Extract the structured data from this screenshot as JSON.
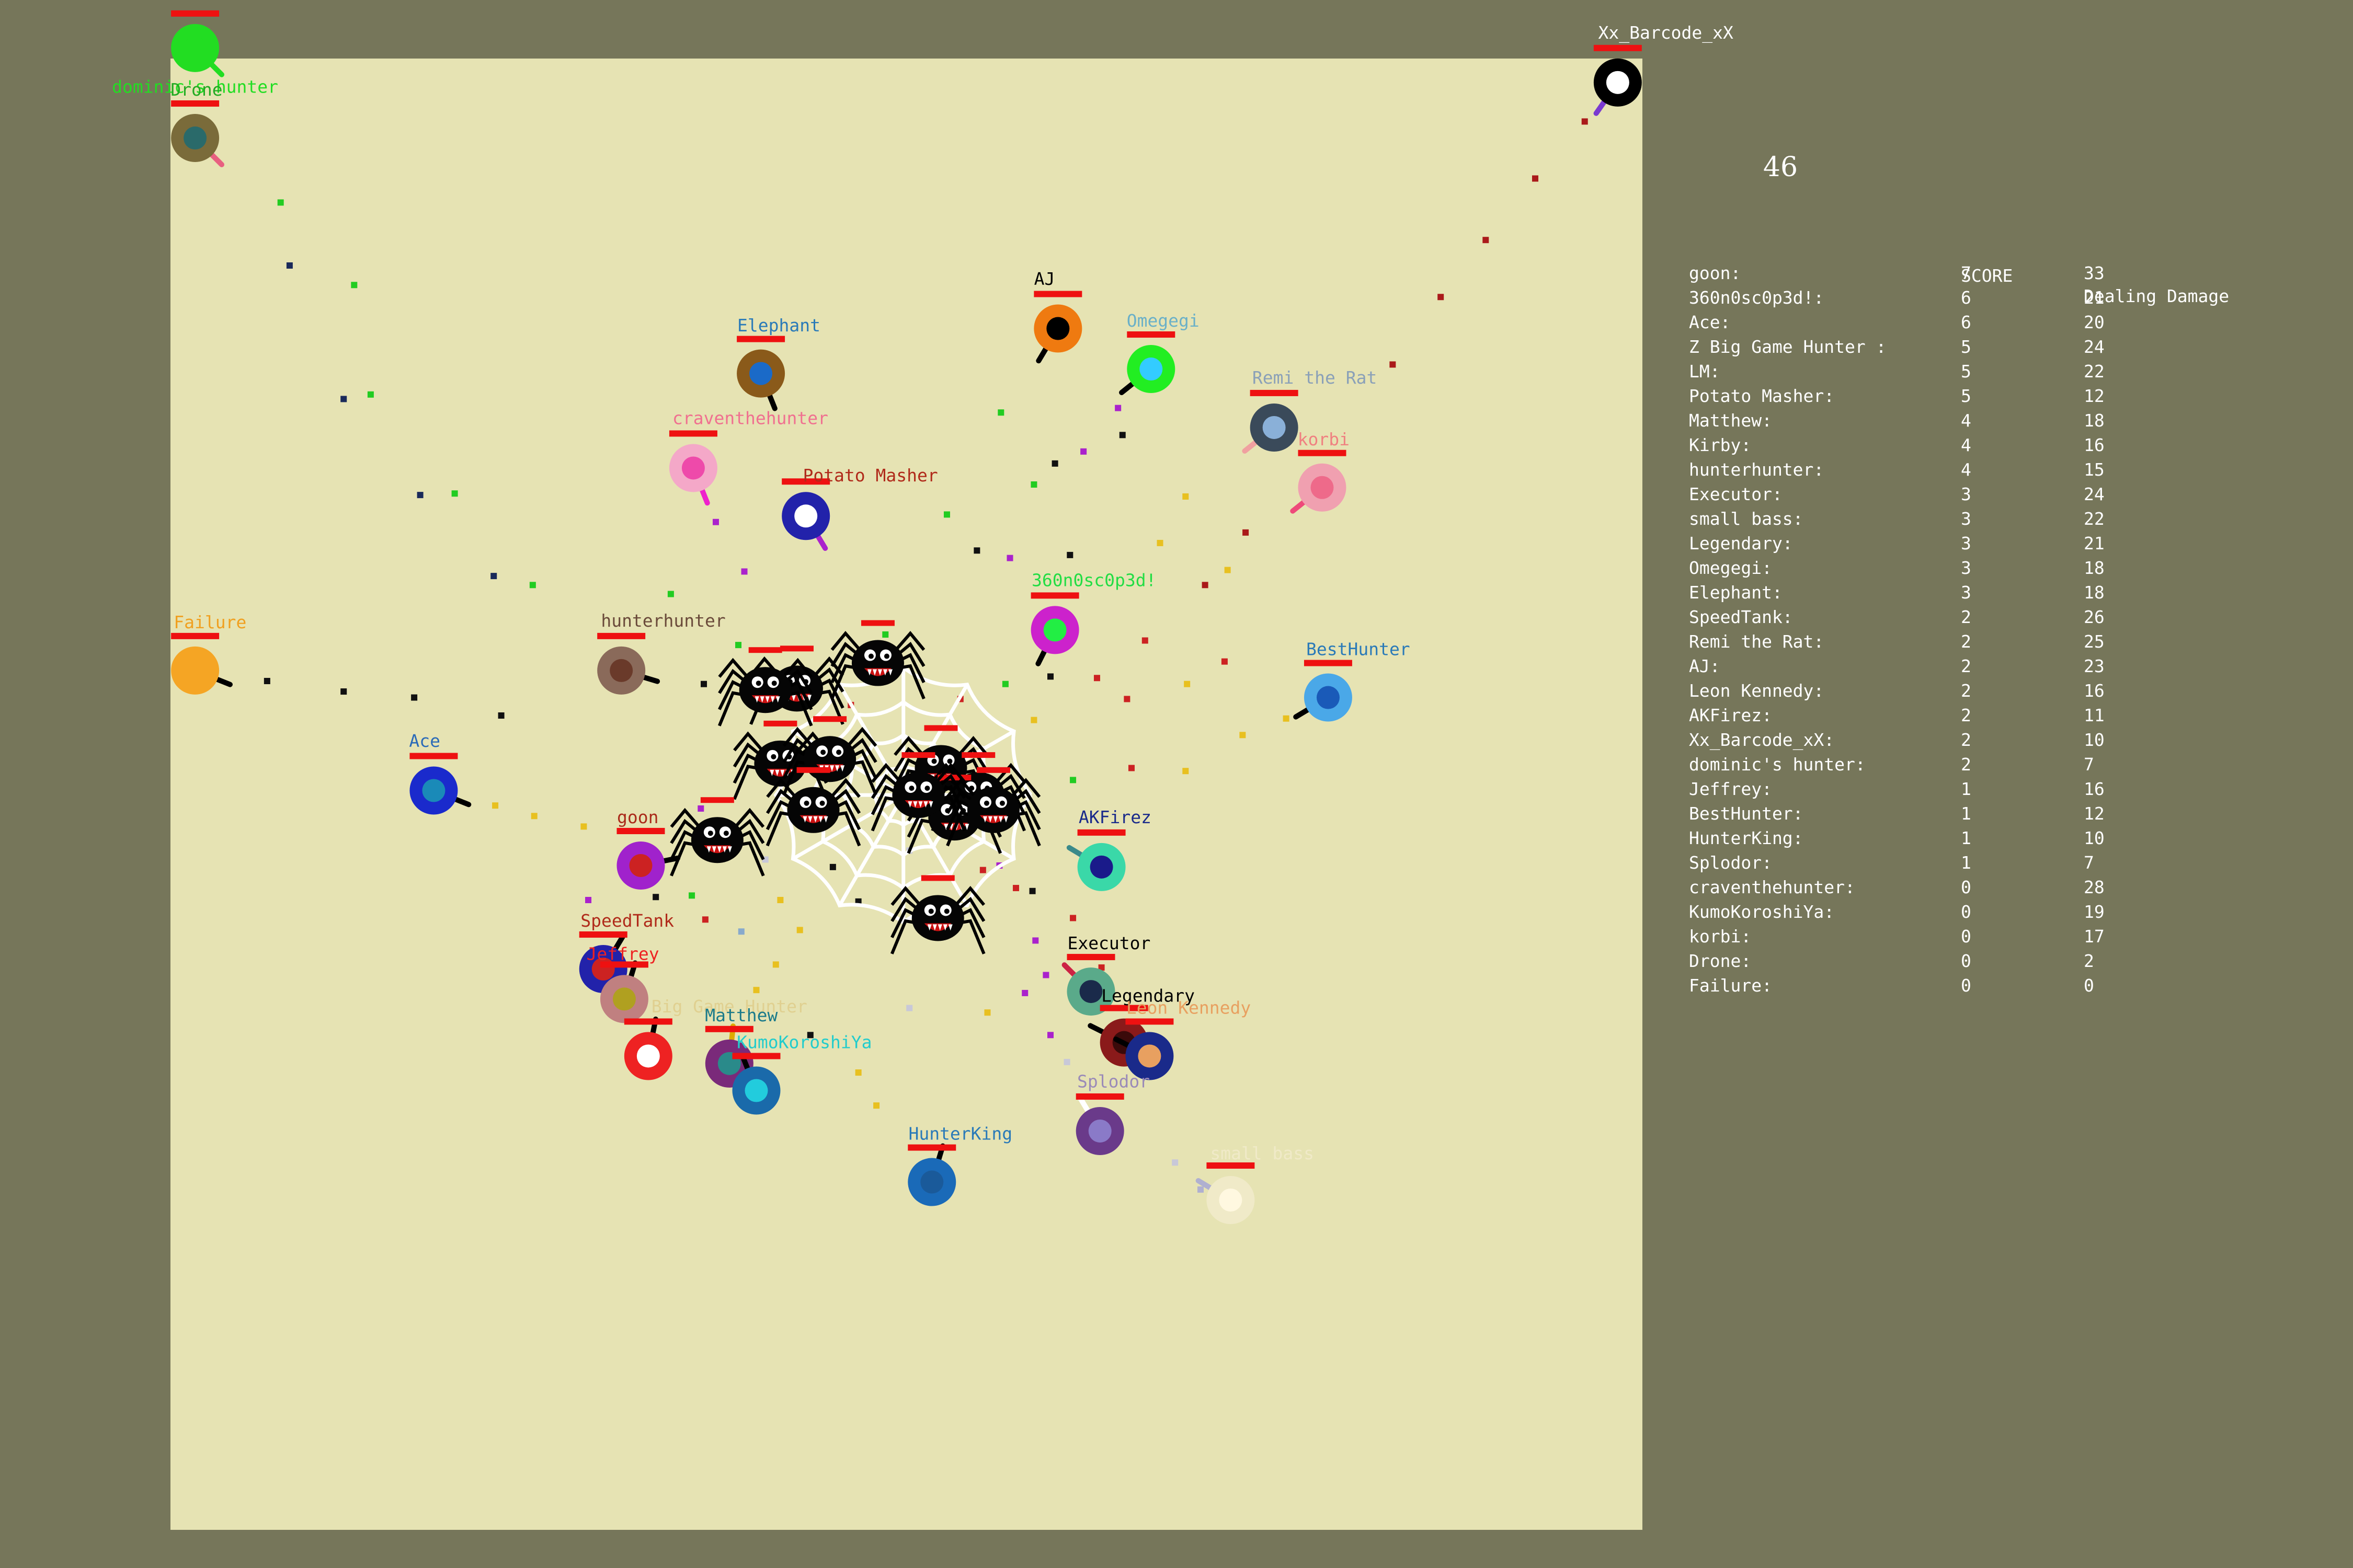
{
  "timer": "46",
  "scoreboard": {
    "headers": [
      "",
      "SCORE",
      "Dealing Damage"
    ],
    "rows": [
      [
        "goon:",
        "7",
        "33"
      ],
      [
        "360n0sc0p3d!:",
        "6",
        "21"
      ],
      [
        "Ace:",
        "6",
        "20"
      ],
      [
        "Z Big Game Hunter :",
        "5",
        "24"
      ],
      [
        "LM:",
        "5",
        "22"
      ],
      [
        "Potato Masher:",
        "5",
        "12"
      ],
      [
        "Matthew:",
        "4",
        "18"
      ],
      [
        "Kirby:",
        "4",
        "16"
      ],
      [
        "hunterhunter:",
        "4",
        "15"
      ],
      [
        "Executor:",
        "3",
        "24"
      ],
      [
        "small bass:",
        "3",
        "22"
      ],
      [
        "Legendary:",
        "3",
        "21"
      ],
      [
        "Omegegi:",
        "3",
        "18"
      ],
      [
        "Elephant:",
        "3",
        "18"
      ],
      [
        "SpeedTank:",
        "2",
        "26"
      ],
      [
        "Remi the Rat:",
        "2",
        "25"
      ],
      [
        "AJ:",
        "2",
        "23"
      ],
      [
        "Leon Kennedy:",
        "2",
        "16"
      ],
      [
        "AKFirez:",
        "2",
        "11"
      ],
      [
        "Xx_Barcode_xX:",
        "2",
        "10"
      ],
      [
        "dominic's hunter:",
        "2",
        "7"
      ],
      [
        "Jeffrey:",
        "1",
        "16"
      ],
      [
        "BestHunter:",
        "1",
        "12"
      ],
      [
        "HunterKing:",
        "1",
        "10"
      ],
      [
        "Splodor:",
        "1",
        "7"
      ],
      [
        "craventhehunter:",
        "0",
        "28"
      ],
      [
        "KumoKoroshiYa:",
        "0",
        "19"
      ],
      [
        "korbi:",
        "0",
        "17"
      ],
      [
        "Drone:",
        "0",
        "2"
      ],
      [
        "Failure:",
        "0",
        "0"
      ]
    ]
  },
  "players": [
    {
      "name": "dominic's hunter",
      "color": "#22dd22",
      "outer": "#22dd22",
      "inner": "#22dd22",
      "barrel": "#22dd22"
    },
    {
      "name": "Drone",
      "color": "#22aa22",
      "outer": "#7a6b3a",
      "inner": "#2a6a6a",
      "barrel": "#e86080"
    },
    {
      "name": "Xx_Barcode_xX",
      "color": "#ffffff",
      "outer": "#000000",
      "inner": "#ffffff",
      "barrel": "#7a3ad0"
    },
    {
      "name": "Elephant",
      "color": "#2a7ab8",
      "outer": "#8a5a1a",
      "inner": "#1a6ac8",
      "barrel": "#000000"
    },
    {
      "name": "AJ",
      "color": "#000000",
      "outer": "#ef7a10",
      "inner": "#000000",
      "barrel": "#000000"
    },
    {
      "name": "Omegegi",
      "color": "#6ab0c8",
      "outer": "#22ee22",
      "inner": "#33ccff",
      "barrel": "#000000"
    },
    {
      "name": "Remi the Rat",
      "color": "#8aa0b8",
      "outer": "#3a4a5a",
      "inner": "#8ab0d8",
      "barrel": "#f0a0a0"
    },
    {
      "name": "korbi",
      "color": "#f08080",
      "outer": "#f0a0b0",
      "inner": "#ee6a8a",
      "barrel": "#ee4a7a"
    },
    {
      "name": "craventhehunter",
      "color": "#f07090",
      "outer": "#f4a8c8",
      "inner": "#ee4aaa",
      "barrel": "#ee22cc"
    },
    {
      "name": "Potato Masher",
      "color": "#b02a1a",
      "outer": "#2222aa",
      "inner": "#ffffff",
      "barrel": "#aa22cc"
    },
    {
      "name": "360n0sc0p3d!",
      "color": "#22dd44",
      "outer": "#cc22cc",
      "inner": "#22ee44",
      "barrel": "#000000"
    },
    {
      "name": "Failure",
      "color": "#f0a020",
      "outer": "#f5a524",
      "inner": "#f5a524",
      "barrel": "#000000"
    },
    {
      "name": "hunterhunter",
      "color": "#6a4a3a",
      "outer": "#8a6a5a",
      "inner": "#6a3a2a",
      "barrel": "#000000"
    },
    {
      "name": "BestHunter",
      "color": "#2a7ab8",
      "outer": "#4aa8e8",
      "inner": "#1a5ab8",
      "barrel": "#000000"
    },
    {
      "name": "Ace",
      "color": "#2a6ab8",
      "outer": "#1a2acc",
      "inner": "#1a8ab8",
      "barrel": "#000000"
    },
    {
      "name": "goon",
      "color": "#aa2a1a",
      "outer": "#a022cc",
      "inner": "#cc2222",
      "barrel": "#000000"
    },
    {
      "name": "AKFirez",
      "color": "#1a2a8a",
      "outer": "#3ad8a8",
      "inner": "#1a1a8a",
      "barrel": "#3a8a8a"
    },
    {
      "name": "SpeedTank",
      "color": "#b02a1a",
      "outer": "#2222aa",
      "inner": "#cc2222",
      "barrel": "#000000"
    },
    {
      "name": "Executor",
      "color": "#000000",
      "outer": "#5aaa8a",
      "inner": "#1a2a4a",
      "barrel": "#cc2244"
    },
    {
      "name": "Legendary",
      "color": "#000000",
      "outer": "#8a1a1a",
      "inner": "#3a0a0a",
      "barrel": "#000000"
    },
    {
      "name": "Leon Kennedy",
      "color": "#e8a060",
      "outer": "#1a2a8a",
      "inner": "#e8a060",
      "barrel": "#000000"
    },
    {
      "name": "Big Game Hunter",
      "color": "#e0d090",
      "outer": "#c08080",
      "inner": "#b0a020",
      "barrel": "#000000"
    },
    {
      "name": "Jeffrey",
      "color": "#ee2222",
      "outer": "#ee2222",
      "inner": "#ffffff",
      "barrel": "#000000"
    },
    {
      "name": "Matthew",
      "color": "#1a7a8a",
      "outer": "#7a2a7a",
      "inner": "#2a8a8a",
      "barrel": "#ddaa00"
    },
    {
      "name": "KumoKoroshiYa",
      "color": "#22cccc",
      "outer": "#1a6aaa",
      "inner": "#22ccdd",
      "barrel": "#000000"
    },
    {
      "name": "Splodor",
      "color": "#9a8ab8",
      "outer": "#6a3a8a",
      "inner": "#8a7ac8",
      "barrel": "#ffffff"
    },
    {
      "name": "HunterKing",
      "color": "#2a7ab8",
      "outer": "#1a6ab8",
      "inner": "#1a5a9a",
      "barrel": "#000000"
    },
    {
      "name": "small bass",
      "color": "#f0eac8",
      "outer": "#f0eac8",
      "inner": "#fff8e0",
      "barrel": "#b0b0d0"
    }
  ]
}
